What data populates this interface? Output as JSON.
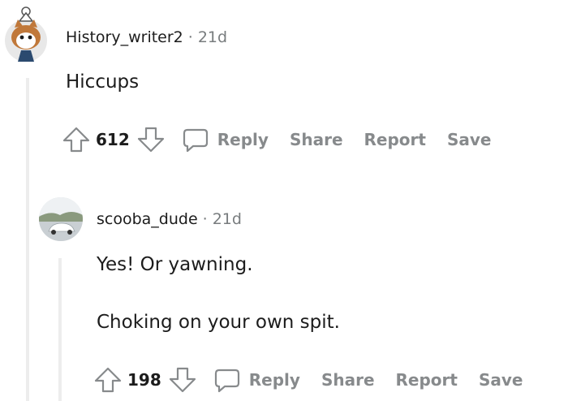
{
  "comments": [
    {
      "username": "History_writer2",
      "separator": "·",
      "age": "21d",
      "body": [
        "Hiccups"
      ],
      "score": "612",
      "actions": {
        "reply": "Reply",
        "share": "Share",
        "report": "Report",
        "save": "Save"
      },
      "avatar": "snoo-avatar"
    },
    {
      "username": "scooba_dude",
      "separator": "·",
      "age": "21d",
      "body": [
        "Yes! Or yawning.",
        "Choking on your own spit."
      ],
      "score": "198",
      "actions": {
        "reply": "Reply",
        "share": "Share",
        "report": "Report",
        "save": "Save"
      },
      "avatar": "car-photo-avatar"
    }
  ],
  "colors": {
    "text": "#1c1c1c",
    "muted": "#878a8c",
    "meta": "#787c7e",
    "thread_line": "#ededed"
  },
  "icons": [
    "upvote-arrow-icon",
    "downvote-arrow-icon",
    "comment-bubble-icon"
  ]
}
